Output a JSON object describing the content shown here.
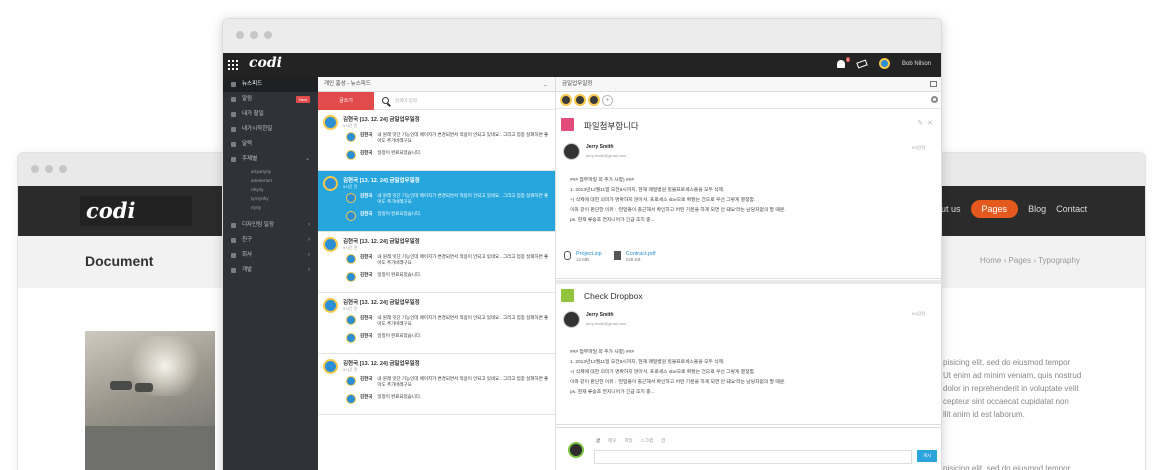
{
  "back_site": {
    "logo": "codi",
    "menu": [
      "out us",
      "Pages",
      "Blog",
      "Contact"
    ],
    "page_title": "Document",
    "breadcrumb": "Home  ›  Pages  ›  Typography",
    "lorem1": [
      "pisicing elit, sed do eiusmod tempor",
      "Ut enim ad minim veniam, quis nostrud",
      "dolor in reprehenderit in voluptate velit",
      "cepteur sint occaecat cupidatat non",
      "llit anim id est laborum."
    ],
    "lorem2": "pisicing elit, sed do eiusmod tempor"
  },
  "app": {
    "logo": "codi",
    "user_name": "Bob Nilson",
    "notif_badge": "6"
  },
  "sidebar": {
    "items": [
      {
        "label": "뉴스피드",
        "active": true
      },
      {
        "label": "알림",
        "new": "New"
      },
      {
        "label": "내가 할일"
      },
      {
        "label": "내가시작한일"
      },
      {
        "label": "달력"
      },
      {
        "label": "주제별",
        "arrow": "⌄"
      }
    ],
    "subitems": [
      "artyartyrty",
      "artertertert",
      "rthyrty",
      "tyrrtyrthy",
      "rtyrty"
    ],
    "groups": [
      {
        "label": "디자인팀 일정",
        "arrow": "›"
      },
      {
        "label": "친구",
        "arrow": "›"
      },
      {
        "label": "회사",
        "arrow": "›"
      },
      {
        "label": "개발",
        "arrow": "›"
      }
    ]
  },
  "list": {
    "header": "개인 홈성 - 뉴스피드",
    "write_label": "글쓰기",
    "search_placeholder": "검색어 입력",
    "posts": [
      {
        "title": "김현국 [13. 12. 24] 금일업무일정",
        "time": "9시간 전",
        "c1_name": "김현국",
        "c1": "내 원래 잇단 기능인데 페이지가 변경되면서 적용이 안되고 있네요.. 그리고 업종 살펴하면 좋아도 추가바래구요",
        "c2_name": "김현국",
        "c2": "일정이 완료되었습니다."
      },
      {
        "title": "김현국 [13. 12. 24] 금일업무일정",
        "time": "9시간 전",
        "c1_name": "김현국",
        "c1": "내 원래 잇단 기능인데 페이지가 변경되면서 적용이 안되고 있네요.. 그리고 업종 살펴하면 좋아도 추가바래구요",
        "c2_name": "김현국",
        "c2": "일정이 완료되었습니다."
      },
      {
        "title": "김현국 [13. 12. 24] 금일업무일정",
        "time": "9시간 전",
        "c1_name": "김현국",
        "c1": "내 원래 잇단 기능인데 페이지가 변경되면서 적용이 안되고 있네요.. 그리고 업종 살펴하면 좋아도 추가바래구요",
        "c2_name": "김현국",
        "c2": "일정이 완료되었습니다."
      },
      {
        "title": "김현국 [13. 12. 24] 금일업무일정",
        "time": "9시간 전",
        "c1_name": "김현국",
        "c1": "내 원래 잇단 기능인데 페이지가 변경되면서 적용이 안되고 있네요.. 그리고 업종 살펴하면 좋아도 추가바래구요",
        "c2_name": "김현국",
        "c2": "일정이 완료되었습니다."
      },
      {
        "title": "김현국 [13. 12. 24] 금일업무일정",
        "time": "9시간 전",
        "c1_name": "김현국",
        "c1": "내 원래 잇단 기능인데 페이지가 변경되면서 적용이 안되고 있네요.. 그리고 업종 살펴하면 좋아도 추가바래구요",
        "c2_name": "김현국",
        "c2": "일정이 완료되었습니다."
      }
    ]
  },
  "detail": {
    "header": "금일업무일정",
    "card1": {
      "title": "파일첨부합니다",
      "author": "Jerry Smith",
      "email": "jerry.smith@gmail.com",
      "time": "9시간전",
      "lines": [
        "### 첨부파일 외 추가 사항) ###",
        "1. 2013년12월11일 오전9시까지, 현재 매일병원 힐뷸프로세스들을 모두 삭제.",
        "+) 삭제에 대한 의미가 명확하지 않아서, 프로세스 sbe으로 확봤는 건으로 우선 그렇게 결정함.",
        "이와 같이 판단한 이유 : '현업들이 출근해서 확인하고 어떤 기분을 하게 되면 안 돼요'라는 남당자없의 말 때문.",
        "ps. 현재 류승호 면지니어가 긴급 조치 중..."
      ],
      "files": [
        {
          "name": "Project.zip",
          "size": "12 MB"
        },
        {
          "name": "Contract.pdf",
          "size": "228 KB"
        }
      ]
    },
    "card2": {
      "title": "Check Dropbox",
      "author": "Jerry Smith",
      "email": "jerry.smith@gmail.com",
      "time": "9시간전",
      "lines": [
        "### 첨부파일 외 추가 사항) ###",
        "1. 2013년12월11일 오전9시까지, 현재 매일병원 힐뷸프로세스들을 모두 삭제.",
        "+) 삭제에 대한 의미가 명확하지 않아서, 프로세스 sbe으로 확봤는 건으로 우선 그렇게 결정함.",
        "이와 같이 판단한 이유 : '현업들이 출근해서 확인하고 어떤 기분을 하게 되면 안 돼요'라는 남당자없의 말 때문.",
        "ps. 현재 류승호 면지니어가 긴급 조치 중..."
      ]
    },
    "composer": {
      "tabs": [
        "글",
        "메모",
        "파일",
        "스크랩",
        "컴"
      ],
      "send": "게시"
    }
  }
}
